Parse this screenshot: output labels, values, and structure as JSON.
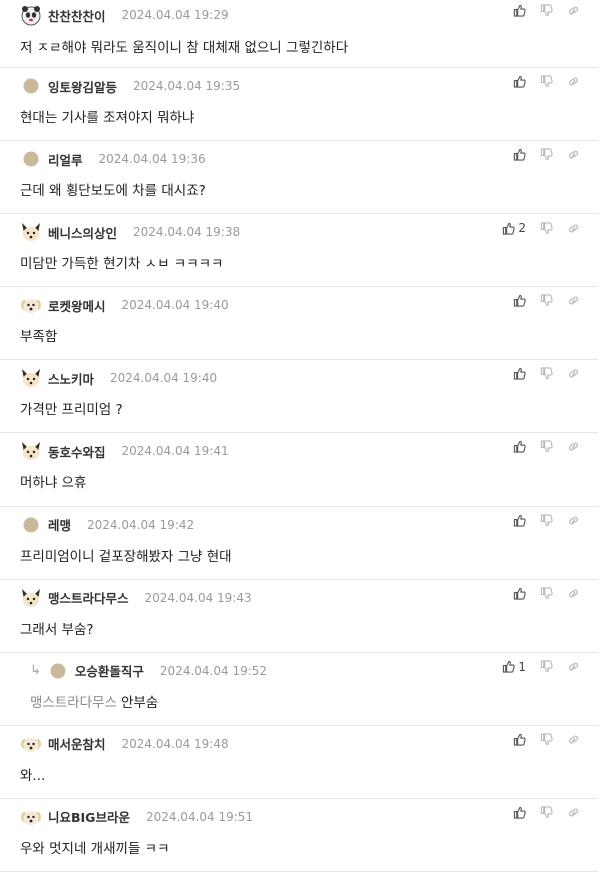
{
  "comments": [
    {
      "nick": "찬찬찬찬이",
      "time": "2024.04.04 19:29",
      "text": "저 ㅈㄹ해야 뭐라도 움직이니 참 대체재 없으니 그렇긴하다",
      "avatar": "panda",
      "likes": "",
      "reply": false,
      "mention": ""
    },
    {
      "nick": "잉토왕김알등",
      "time": "2024.04.04 19:35",
      "text": "현대는 기사를 조져야지 뭐하냐",
      "avatar": "dot",
      "likes": "",
      "reply": false,
      "mention": ""
    },
    {
      "nick": "리얼루",
      "time": "2024.04.04 19:36",
      "text": "근데 왜 횡단보도에 차를 대시죠?",
      "avatar": "dot",
      "likes": "",
      "reply": false,
      "mention": ""
    },
    {
      "nick": "베니스의상인",
      "time": "2024.04.04 19:38",
      "text": "미담만 가득한 현기차 ㅅㅂ ㅋㅋㅋㅋ",
      "avatar": "fox",
      "likes": "2",
      "reply": false,
      "mention": ""
    },
    {
      "nick": "로켓왕메시",
      "time": "2024.04.04 19:40",
      "text": "부족함",
      "avatar": "puppy",
      "likes": "",
      "reply": false,
      "mention": ""
    },
    {
      "nick": "스노키마",
      "time": "2024.04.04 19:40",
      "text": "가격만 프리미엄 ?",
      "avatar": "fox",
      "likes": "",
      "reply": false,
      "mention": ""
    },
    {
      "nick": "동호수와집",
      "time": "2024.04.04 19:41",
      "text": "머하냐 으휴",
      "avatar": "fox",
      "likes": "",
      "reply": false,
      "mention": ""
    },
    {
      "nick": "레맹",
      "time": "2024.04.04 19:42",
      "text": "프리미엄이니 겉포장해봤자 그냥 현대",
      "avatar": "dot",
      "likes": "",
      "reply": false,
      "mention": ""
    },
    {
      "nick": "맹스트라다무스",
      "time": "2024.04.04 19:43",
      "text": "그래서 부숨?",
      "avatar": "fox",
      "likes": "",
      "reply": false,
      "mention": ""
    },
    {
      "nick": "오승환돌직구",
      "time": "2024.04.04 19:52",
      "text": "안부숨",
      "avatar": "dot",
      "likes": "1",
      "reply": true,
      "mention": "맹스트라다무스"
    },
    {
      "nick": "매서운참치",
      "time": "2024.04.04 19:48",
      "text": "와...",
      "avatar": "puppy",
      "likes": "",
      "reply": false,
      "mention": ""
    },
    {
      "nick": "니요BIG브라운",
      "time": "2024.04.04 19:51",
      "text": "우와 멋지네 개새끼들 ㅋㅋ",
      "avatar": "puppy",
      "likes": "",
      "reply": false,
      "mention": ""
    }
  ],
  "icons": {
    "like": "thumbs-up-icon",
    "dislike": "thumbs-down-icon",
    "link": "link-icon",
    "reply": "reply-arrow-icon"
  },
  "colors": {
    "divider": "#e6e6e6",
    "timestamp": "#9a9a9a",
    "mention": "#8a8a8a",
    "placeholder_avatar": "#c9b99a"
  }
}
